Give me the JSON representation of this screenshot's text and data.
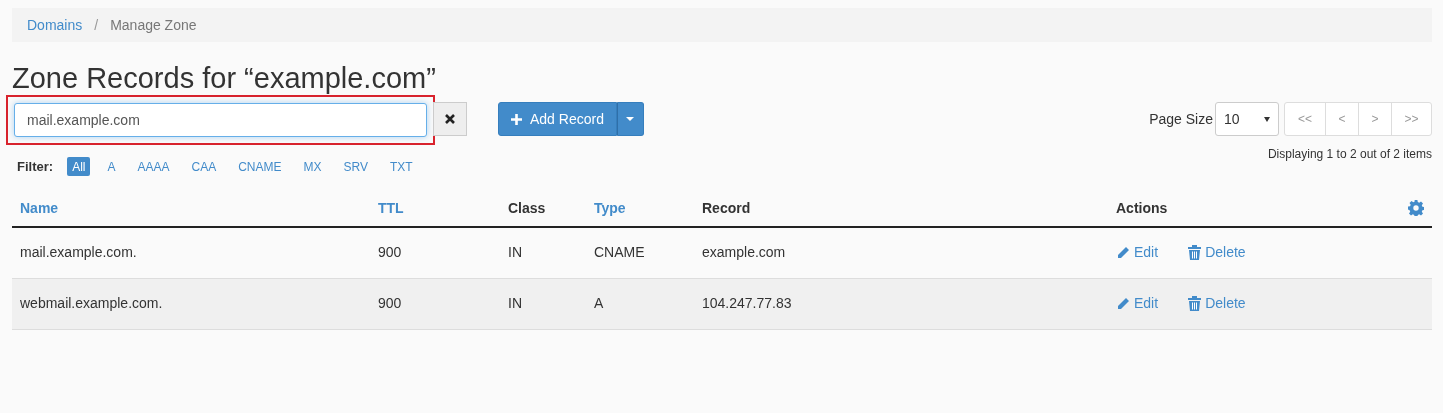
{
  "breadcrumb": [
    {
      "label": "Domains",
      "kind": "link"
    },
    {
      "label": "/",
      "kind": "separator"
    },
    {
      "label": "Manage Zone",
      "kind": "current"
    }
  ],
  "title": "Zone Records for “example.com”",
  "search": {
    "value": "mail.example.com",
    "highlighted": true
  },
  "add_button": {
    "label": "Add Record"
  },
  "filter": {
    "label": "Filter:",
    "options": [
      {
        "label": "All",
        "selected": true
      },
      {
        "label": "A",
        "selected": false
      },
      {
        "label": "AAAA",
        "selected": false
      },
      {
        "label": "CAA",
        "selected": false
      },
      {
        "label": "CNAME",
        "selected": false
      },
      {
        "label": "MX",
        "selected": false
      },
      {
        "label": "SRV",
        "selected": false
      },
      {
        "label": "TXT",
        "selected": false
      }
    ]
  },
  "pagination": {
    "page_size_label": "Page Size",
    "page_size": "10",
    "buttons": [
      "<<",
      "<",
      ">",
      ">>"
    ],
    "summary": "Displaying 1 to 2 out of 2 items"
  },
  "table": {
    "columns": [
      {
        "label": "Name",
        "kind": "link"
      },
      {
        "label": "TTL",
        "kind": "link"
      },
      {
        "label": "Class",
        "kind": "plain"
      },
      {
        "label": "Type",
        "kind": "link"
      },
      {
        "label": "Record",
        "kind": "plain"
      },
      {
        "label": "Actions",
        "kind": "plain"
      }
    ],
    "rows": [
      {
        "cells": [
          "mail.example.com.",
          "900",
          "IN",
          "CNAME",
          "example.com"
        ],
        "actions": [
          "Edit",
          "Delete"
        ]
      },
      {
        "cells": [
          "webmail.example.com.",
          "900",
          "IN",
          "A",
          "104.247.77.83"
        ],
        "actions": [
          "Edit",
          "Delete"
        ]
      }
    ]
  }
}
